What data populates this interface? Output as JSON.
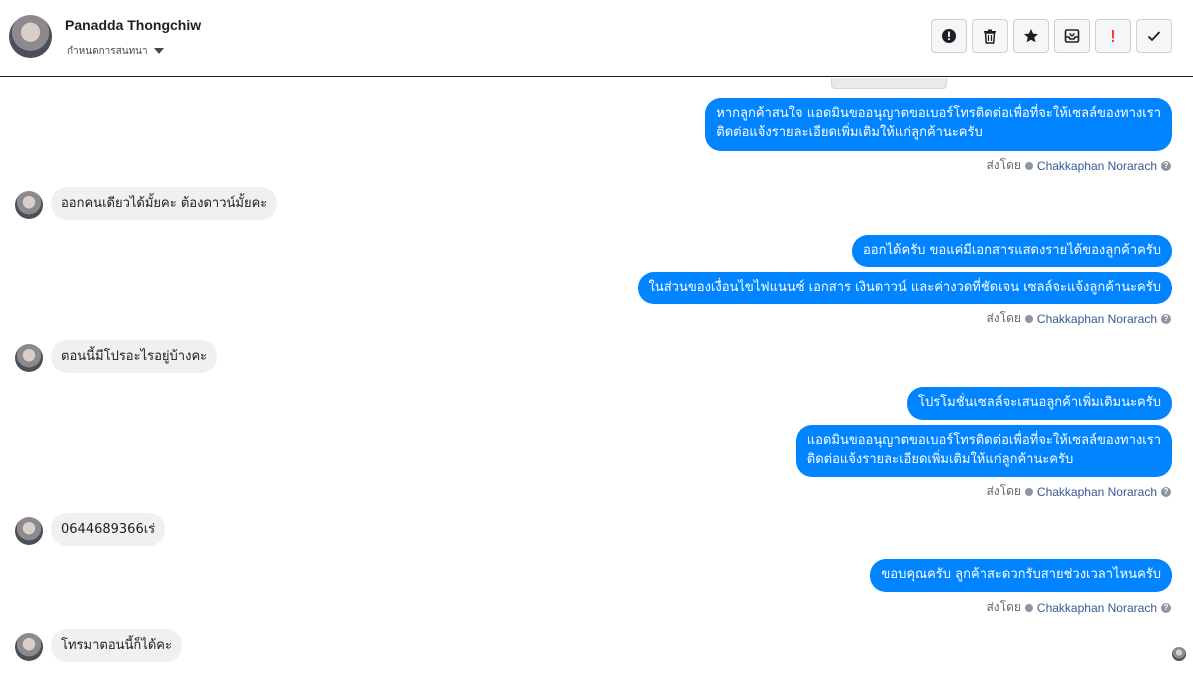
{
  "header": {
    "contact_name": "Panadda Thongchiw",
    "label_dropdown": "กำหนดการสนทนา",
    "toolbar": [
      "alert-circle-icon",
      "trash-icon",
      "star-icon",
      "archive-icon",
      "priority-icon",
      "check-icon"
    ]
  },
  "colors": {
    "outgoing": "#0084ff",
    "incoming": "#f1f0f0",
    "agent_link": "#385898"
  },
  "messages": {
    "m1": "หากลูกค้าสนใจ แอดมินขออนุญาตขอเบอร์โทรติดต่อเพื่อที่จะให้เซลล์ของทางเรา",
    "m1b": "ติดต่อแจ้งรายละเอียดเพิ่มเติมให้แก่ลูกค้านะครับ",
    "m2": "ออกคนเดียวได้มั้ยคะ ต้องดาวน์มั้ยคะ",
    "m3": "ออกได้ครับ ขอแค่มีเอกสารแสดงรายได้ของลูกค้าครับ",
    "m4": "ในส่วนของเงื่อนไขไฟแนนซ์ เอกสาร เงินดาวน์ และค่างวดที่ชัดเจน เซลล์จะแจ้งลูกค้านะครับ",
    "m5": "ตอนนี้มีโปรอะไรอยู่บ้างคะ",
    "m6": "โปรโมชั่นเซลล์จะเสนอลูกค้าเพิ่มเติมนะครับ",
    "m7": "แอดมินขออนุญาตขอเบอร์โทรติดต่อเพื่อที่จะให้เซลล์ของทางเรา",
    "m7b": "ติดต่อแจ้งรายละเอียดเพิ่มเติมให้แก่ลูกค้านะครับ",
    "m8": "0644689366เร่",
    "m9": "ขอบคุณครับ ลูกค้าสะดวกรับสายช่วงเวลาไหนครับ",
    "m10": "โทรมาตอนนี้ก็ได้คะ"
  },
  "sent_by": {
    "prefix": "ส่งโดย",
    "agent": "Chakkaphan Norarach"
  }
}
